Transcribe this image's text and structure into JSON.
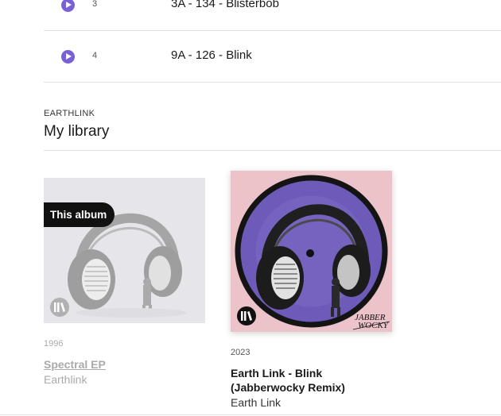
{
  "tracks": [
    {
      "number": "3",
      "title": "3A - 134 - Blisterbob"
    },
    {
      "number": "4",
      "title": "9A - 126 - Blink"
    }
  ],
  "library": {
    "kicker": "EARTHLINK",
    "title": "My library",
    "albums": [
      {
        "badge": "This album",
        "year": "1996",
        "title": "Spectral EP",
        "artist": "Earthlink"
      },
      {
        "year": "2023",
        "title": "Earth Link - Blink (Jabberwocky Remix)",
        "artist": "Earth Link",
        "cover_signature": "JABBER WOCKY"
      }
    ]
  },
  "colors": {
    "play_accent": "#7b5fd6",
    "cover_purple": "#6e5ab8",
    "cover_pink": "#ecc3c8"
  }
}
